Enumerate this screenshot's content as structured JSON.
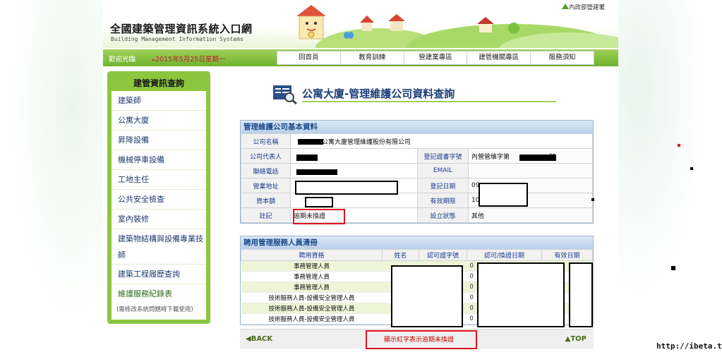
{
  "header": {
    "site_title": "全國建築管理資訊系統入口網",
    "site_subtitle": "Building Management Information Systems",
    "ministry": "內政部營建署"
  },
  "navbar": {
    "welcome": "歡迎光臨",
    "date": "2015年5月25日星期一",
    "items": [
      "回首頁",
      "教育訓練",
      "營建業專區",
      "建管機關專區",
      "服務須知"
    ]
  },
  "sidebar": {
    "title": "建管資訊查詢",
    "items": [
      "建築師",
      "公寓大廈",
      "昇降設備",
      "機械停車設備",
      "工地主任",
      "公共安全檢查",
      "室內裝修",
      "建築物結構與設備專業技師",
      "建築工程履歷查詢",
      "維護服務紀錄表"
    ],
    "note": "(需修改系統問題時下載使用)"
  },
  "page": {
    "title": "公寓大廈-管理維護公司資料查詢"
  },
  "company_panel": {
    "title": "管理維護公司基本資料",
    "labels": {
      "name": "公司名稱",
      "representative": "公司代表人",
      "phone": "聯絡電話",
      "address": "營業地址",
      "capital": "資本額",
      "remark": "註記",
      "cert_no": "登記證書字號",
      "email": "EMAIL",
      "reg_date": "登記日期",
      "valid_until": "有效期限",
      "status": "設立狀態"
    },
    "values": {
      "name": "公寓大廈管理維護股份有限公司",
      "cert_no_prefix": "內營管維字第",
      "cert_no_suffix": "號",
      "reg_date_prefix": "09",
      "valid_until_prefix": "10",
      "remark": "逾期未換證",
      "status": "其他"
    }
  },
  "staff_panel": {
    "title": "聘用管理服務人員清冊",
    "columns": [
      "聘用資格",
      "姓名",
      "認可證字號",
      "認可/換證日期",
      "有效日期"
    ],
    "rows": [
      {
        "role": "事務管理人員",
        "date_prefix": "0"
      },
      {
        "role": "事務管理人員",
        "date_prefix": "0"
      },
      {
        "role": "事務管理人員",
        "date_prefix": "0"
      },
      {
        "role": "技術服務人員-設備安全管理人員",
        "date_prefix": "0"
      },
      {
        "role": "技術服務人員-設備安全管理人員",
        "date_prefix": "0"
      },
      {
        "role": "技術服務人員-設備安全管理人員",
        "date_prefix": "0"
      }
    ]
  },
  "footer": {
    "back": "◀BACK",
    "note": "顯示紅字表示逾期未換證",
    "top": "▲TOP"
  },
  "watermark": "http://ibeta.tw"
}
